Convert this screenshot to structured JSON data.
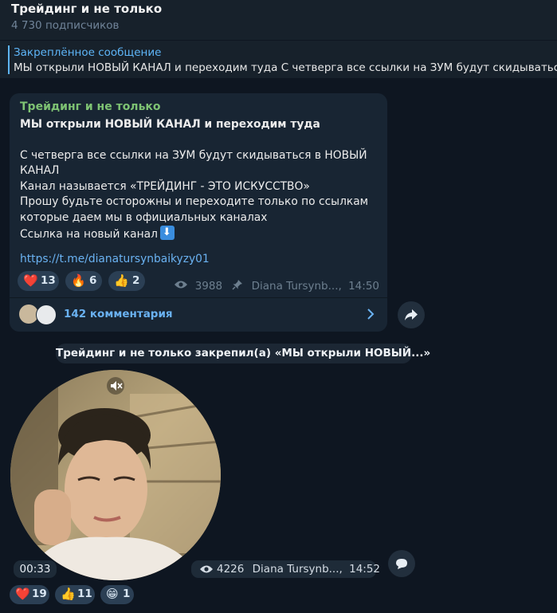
{
  "channel": {
    "title": "Трейдинг и не только",
    "subscribers": "4 730 подписчиков"
  },
  "pinned": {
    "label": "Закреплённое сообщение",
    "text": "МЫ открыли НОВЫЙ КАНАЛ и переходим туда   С четверга все  ссылки на ЗУМ будут скидываться"
  },
  "message": {
    "author": "Трейдинг и не только",
    "title": "МЫ открыли НОВЫЙ КАНАЛ и переходим туда",
    "line1": "С четверга все  ссылки на ЗУМ будут скидываться в НОВЫЙ КАНАЛ",
    "line2": "Канал называется «ТРЕЙДИНГ - ЭТО ИСКУССТВО»",
    "line3": "Прошу будьте осторожны и переходите только по ссылкам которые даем мы в официальных каналах",
    "line4": "Ссылка на новый канал",
    "link_emoji": "down-arrow-emoji",
    "link": "https://t.me/dianatursynbaikyzy01",
    "reactions": [
      {
        "icon": "❤️",
        "count": "13",
        "name": "heart"
      },
      {
        "icon": "🔥",
        "count": "6",
        "name": "fire"
      },
      {
        "icon": "👍",
        "count": "2",
        "name": "thumbs-up"
      }
    ],
    "views": "3988",
    "signature": "Diana Tursynb...,",
    "time": "14:50",
    "comments": "142 комментария"
  },
  "service_message": "Трейдинг и не только закрепил(а) «МЫ открыли НОВЫЙ...»",
  "video_message": {
    "duration": "00:33",
    "views": "4226",
    "signature": "Diana Tursynb...,",
    "time": "14:52",
    "reactions": [
      {
        "icon": "❤️",
        "count": "19",
        "name": "heart"
      },
      {
        "icon": "👍",
        "count": "11",
        "name": "thumbs-up"
      },
      {
        "icon": "😁",
        "count": "1",
        "name": "grin"
      }
    ]
  },
  "colors": {
    "background": "#0e1621",
    "panel": "#17212b",
    "bubble": "#182533",
    "accent": "#5eb5f7",
    "author": "#7ec373",
    "link": "#6ab2f2"
  }
}
